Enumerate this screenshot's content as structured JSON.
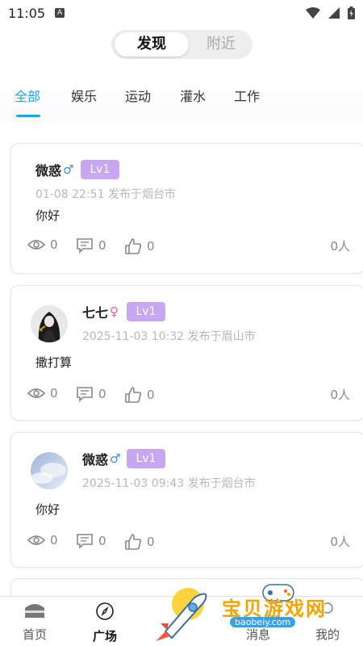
{
  "status": {
    "time": "11:05",
    "notif_icon": "A"
  },
  "segment": {
    "active": "发现",
    "inactive": "附近"
  },
  "tabs": [
    {
      "label": "全部",
      "active": true
    },
    {
      "label": "娱乐"
    },
    {
      "label": "运动"
    },
    {
      "label": "灌水"
    },
    {
      "label": "工作"
    }
  ],
  "posts": [
    {
      "name": "微惑",
      "gender": "♂",
      "level": "Lv1",
      "meta": "01-08 22:51 发布于烟台市",
      "content": "你好",
      "views": "0",
      "comments": "0",
      "likes": "0",
      "people": "0人",
      "avatar": "none"
    },
    {
      "name": "七七",
      "gender": "♀",
      "level": "Lv1",
      "meta": "2025-11-03 10:32 发布于眉山市",
      "content": "撒打算",
      "views": "0",
      "comments": "0",
      "likes": "0",
      "people": "0人",
      "avatar": "girl-avatar"
    },
    {
      "name": "微惑",
      "gender": "♂",
      "level": "Lv1",
      "meta": "2025-11-03 09:43 发布于烟台市",
      "content": "你好",
      "views": "0",
      "comments": "0",
      "likes": "0",
      "people": "0人",
      "avatar": "sky-avatar"
    }
  ],
  "nav": {
    "home": "首页",
    "square": "广场",
    "message": "消息",
    "mine": "我的"
  },
  "watermark": {
    "text": "宝贝游戏网",
    "url": "baobeiy.com"
  },
  "colors": {
    "accent": "#1aa6e6",
    "level_bg": "#c7a6f2",
    "male": "#3a8df0",
    "female": "#e257b4"
  }
}
